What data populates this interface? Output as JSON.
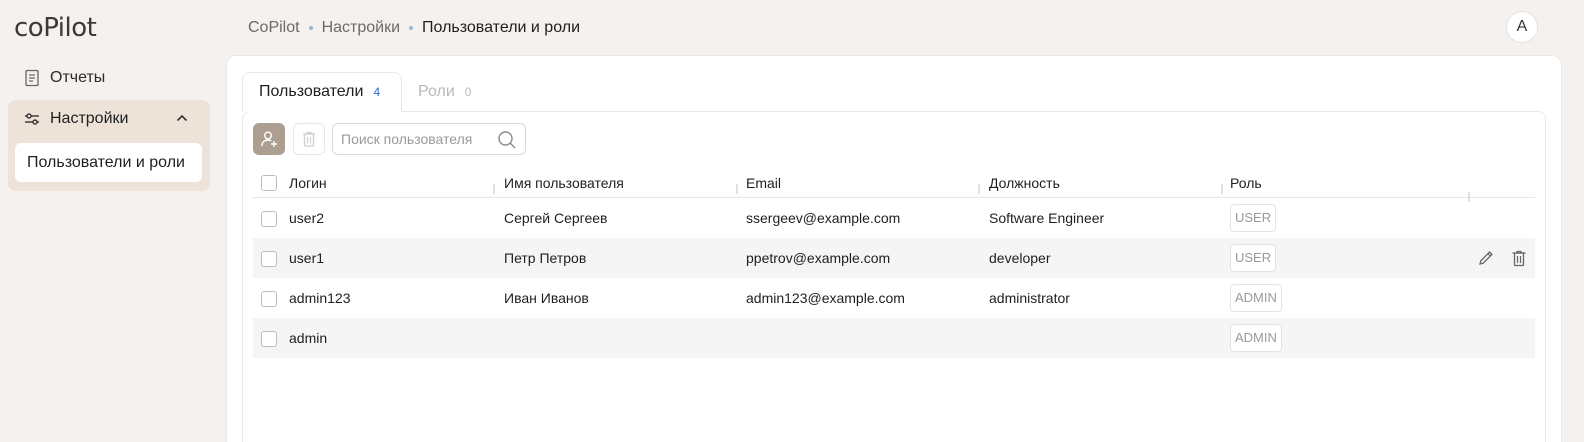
{
  "app": {
    "logo_text": "coPilot"
  },
  "sidebar": {
    "reports_label": "Отчеты",
    "settings_label": "Настройки",
    "users_roles_label": "Пользователи и роли"
  },
  "breadcrumb": {
    "items": [
      "CoPilot",
      "Настройки",
      "Пользователи и роли"
    ]
  },
  "avatar": {
    "initial": "A"
  },
  "tabs": {
    "users": {
      "label": "Пользователи",
      "count": "4"
    },
    "roles": {
      "label": "Роли",
      "count": "0"
    }
  },
  "toolbar": {
    "search_placeholder": "Поиск пользователя"
  },
  "table": {
    "columns": [
      "Логин",
      "Имя пользователя",
      "Email",
      "Должность",
      "Роль"
    ],
    "rows": [
      {
        "login": "user2",
        "name": "Сергей Сергеев",
        "email": "ssergeev@example.com",
        "position": "Software Engineer",
        "role": "USER"
      },
      {
        "login": "user1",
        "name": "Петр Петров",
        "email": "ppetrov@example.com",
        "position": "developer",
        "role": "USER"
      },
      {
        "login": "admin123",
        "name": "Иван Иванов",
        "email": "admin123@example.com",
        "position": "administrator",
        "role": "ADMIN"
      },
      {
        "login": "admin",
        "name": "",
        "email": "",
        "position": "",
        "role": "ADMIN"
      }
    ]
  },
  "colors": {
    "accent_button": "#ac9f91",
    "sidebar_active_bg": "#ede3d8",
    "tab_count": "#2a6bd0",
    "page_bg": "#f4f1ee"
  }
}
